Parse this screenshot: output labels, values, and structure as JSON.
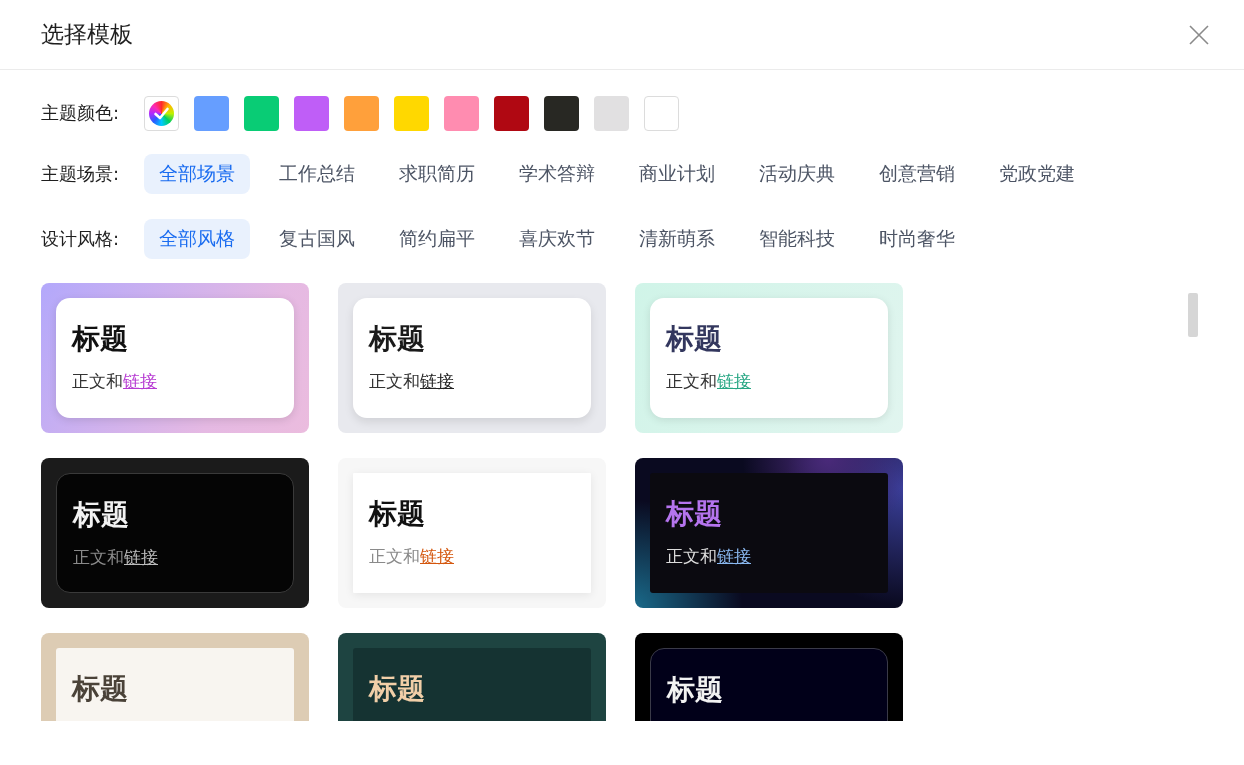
{
  "dialog": {
    "title": "选择模板"
  },
  "theme_colors": {
    "label": "主题颜色:",
    "swatches": [
      {
        "kind": "rainbow",
        "selected": true
      },
      {
        "kind": "solid",
        "color": "#669eff",
        "selected": false
      },
      {
        "kind": "solid",
        "color": "#09cc75",
        "selected": false
      },
      {
        "kind": "solid",
        "color": "#bf5ef7",
        "selected": false
      },
      {
        "kind": "solid",
        "color": "#ffa03b",
        "selected": false
      },
      {
        "kind": "solid",
        "color": "#ffd800",
        "selected": false
      },
      {
        "kind": "solid",
        "color": "#ff8cb0",
        "selected": false
      },
      {
        "kind": "solid",
        "color": "#b00812",
        "selected": false
      },
      {
        "kind": "solid",
        "color": "#282823",
        "selected": false
      },
      {
        "kind": "solid",
        "color": "#e1e0e1",
        "selected": false
      },
      {
        "kind": "solid",
        "color": "#ffffff",
        "selected": false
      }
    ]
  },
  "scene_filter": {
    "label": "主题场景:",
    "options": [
      {
        "label": "全部场景",
        "selected": true
      },
      {
        "label": "工作总结",
        "selected": false
      },
      {
        "label": "求职简历",
        "selected": false
      },
      {
        "label": "学术答辩",
        "selected": false
      },
      {
        "label": "商业计划",
        "selected": false
      },
      {
        "label": "活动庆典",
        "selected": false
      },
      {
        "label": "创意营销",
        "selected": false
      },
      {
        "label": "党政党建",
        "selected": false
      }
    ]
  },
  "style_filter": {
    "label": "设计风格:",
    "options": [
      {
        "label": "全部风格",
        "selected": true
      },
      {
        "label": "复古国风",
        "selected": false
      },
      {
        "label": "简约扁平",
        "selected": false
      },
      {
        "label": "喜庆欢节",
        "selected": false
      },
      {
        "label": "清新萌系",
        "selected": false
      },
      {
        "label": "智能科技",
        "selected": false
      },
      {
        "label": "时尚奢华",
        "selected": false
      }
    ]
  },
  "templates": [
    {
      "kind": "gradient",
      "title": "标题",
      "body": "正文和",
      "link": "链接"
    },
    {
      "kind": "neutral",
      "title": "标题",
      "body": "正文和",
      "link": "链接"
    },
    {
      "kind": "mint",
      "title": "标题",
      "body": "正文和",
      "link": "链接"
    },
    {
      "kind": "dark",
      "title": "标题",
      "body": "正文和",
      "link": "链接"
    },
    {
      "kind": "paper",
      "title": "标题",
      "body": "正文和",
      "link": "链接"
    },
    {
      "kind": "neon",
      "title": "标题",
      "body": "正文和",
      "link": "链接"
    },
    {
      "kind": "beige",
      "title": "标题"
    },
    {
      "kind": "forest",
      "title": "标题"
    },
    {
      "kind": "midnight",
      "title": "标题"
    }
  ]
}
